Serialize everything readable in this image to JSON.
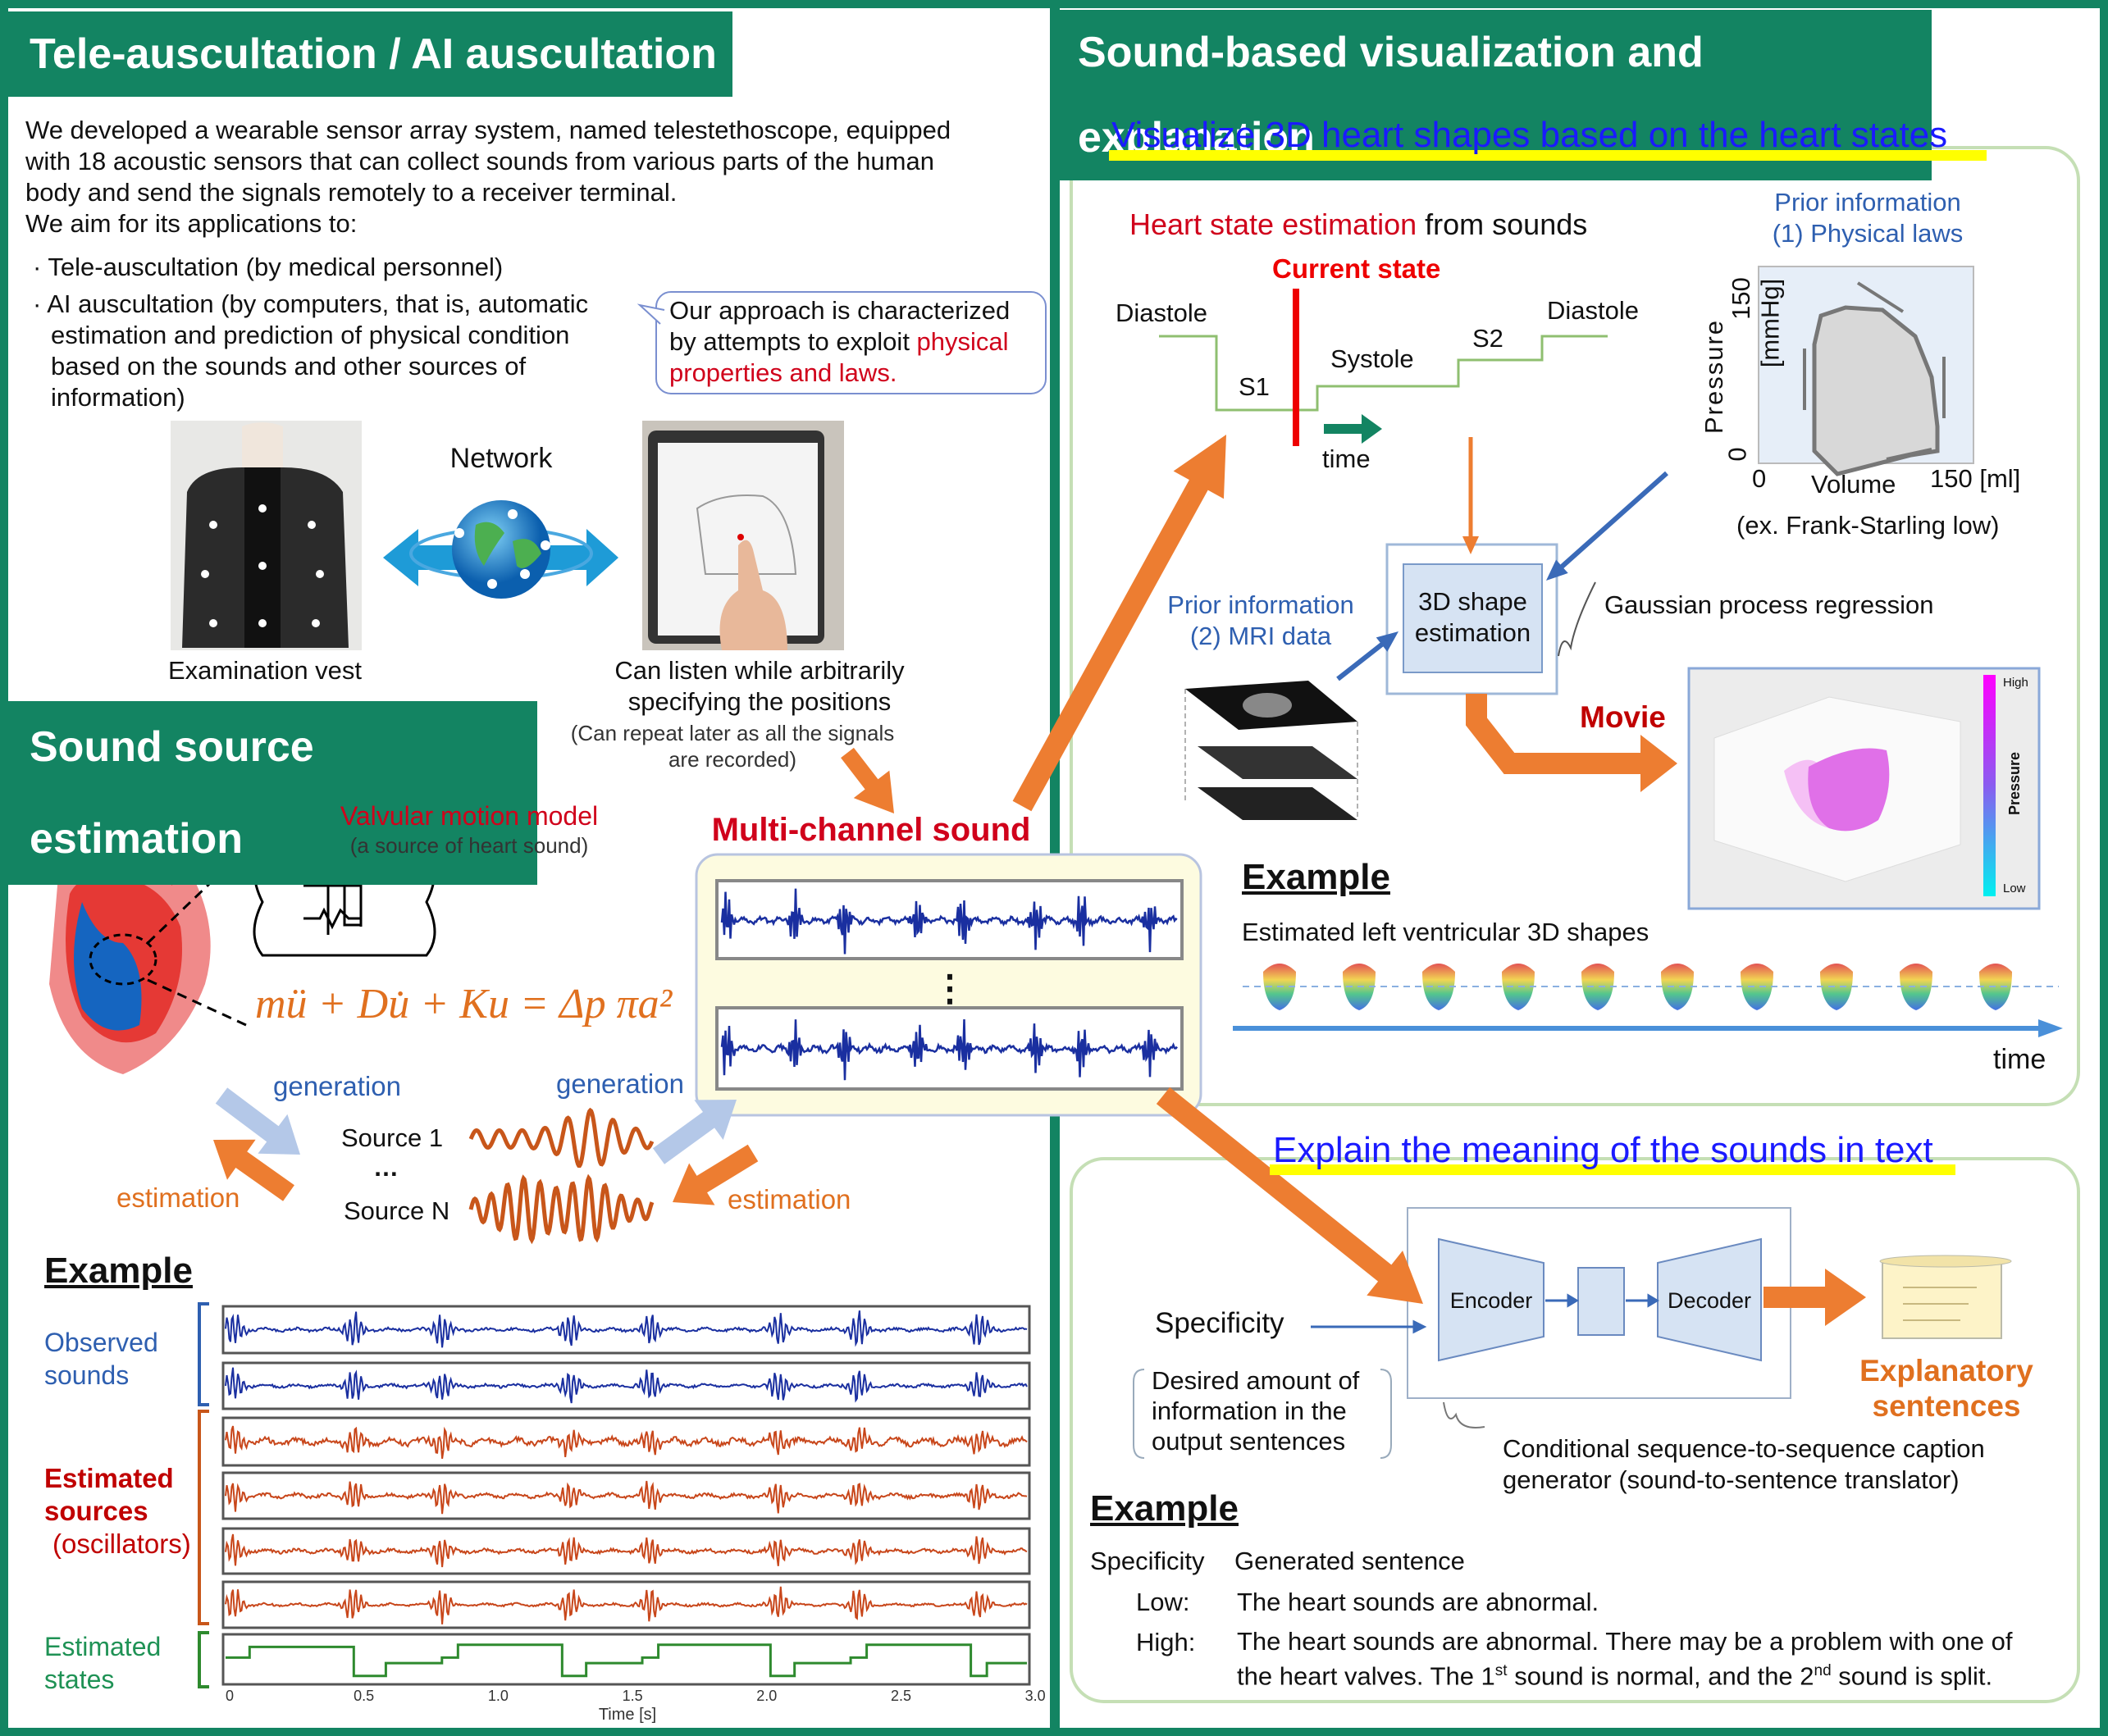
{
  "colors": {
    "frame_green": "#138462",
    "accent_orange": "#ed7d31",
    "accent_red": "#d0021b",
    "prior_blue": "#2e5fb0",
    "highlight_yellow": "#ffff00"
  },
  "left": {
    "title": "Tele-auscultation / AI auscultation",
    "intro": [
      "We developed a wearable sensor array system, named telestethoscope, equipped",
      "with 18 acoustic sensors that can collect sounds from various parts of the human",
      "body and send the signals remotely to a receiver terminal.",
      "We aim for its applications to:"
    ],
    "bullet_1": "Tele-auscultation (by medical personnel)",
    "bullet_2_lines": [
      "AI auscultation (by computers, that is, automatic",
      "estimation and prediction of physical condition",
      "based on the sounds and other sources of",
      "information)"
    ],
    "callout": {
      "line1": "Our approach is characterized",
      "line2": "by attempts to exploit ",
      "line2_red": "physical",
      "line3_red": "properties and laws."
    },
    "vest_label": "Examination vest",
    "network_label": "Network",
    "listen_lines": [
      "Can listen while arbitrarily",
      "specifying the positions"
    ],
    "repeat_lines": [
      "(Can repeat later as all the signals",
      "are recorded)"
    ]
  },
  "source": {
    "title": "Sound source estimation",
    "valve_title": "Valvular motion model",
    "valve_sub": "(a source of heart sound)",
    "equation": "mü + Du̇ + Ku = Δp πa²",
    "generation": "generation",
    "estimation": "estimation",
    "source_1": "Source 1",
    "ellipsis": "…",
    "source_n": "Source N",
    "multichannel": "Multi-channel sound",
    "vdots": "⋮"
  },
  "example_left": {
    "heading": "Example",
    "observed": [
      "Observed",
      "sounds"
    ],
    "estimated_sources": [
      "Estimated",
      "sources"
    ],
    "oscillators": "(oscillators)",
    "estimated_states": [
      "Estimated",
      "states"
    ],
    "x_ticks": [
      "0",
      "0.5",
      "1.0",
      "1.5",
      "2.0",
      "2.5",
      "3.0"
    ],
    "x_label": "Time [s]"
  },
  "right": {
    "title": "Sound-based visualization and explanation",
    "viz_title": "Visualize 3D heart shapes based on the heart states",
    "hse_red": "Heart state estimation",
    "hse_black": " from sounds",
    "current_state": "Current state",
    "diastole": "Diastole",
    "systole": "Systole",
    "s1": "S1",
    "s2": "S2",
    "time": "time",
    "prior1": [
      "Prior information",
      "(1) Physical laws"
    ],
    "pv": {
      "y_label": "Pressure",
      "y_max": "150",
      "y_unit": "[mmHg]",
      "y_min": "0",
      "x_min": "0",
      "x_label": "Volume",
      "x_max": "150 [ml]"
    },
    "frank": "(ex. Frank-Starling low)",
    "prior2": [
      "Prior information",
      "(2) MRI data"
    ],
    "shape_est": [
      "3D shape",
      "estimation"
    ],
    "gpr": "Gaussian process regression",
    "movie": "Movie",
    "colorbar": {
      "high": "High",
      "label": "Pressure",
      "low": "Low"
    },
    "example": "Example",
    "lv_label": "Estimated left ventricular 3D shapes",
    "time2": "time",
    "explain_title": "Explain the meaning of the sounds in text",
    "encoder": "Encoder",
    "decoder": "Decoder",
    "specificity": "Specificity",
    "desired": [
      "Desired amount of",
      "information in the",
      "output sentences"
    ],
    "explanatory": [
      "Explanatory",
      "sentences"
    ],
    "generator": [
      "Conditional sequence-to-sequence caption",
      "generator (sound-to-sentence translator)"
    ],
    "example2": "Example",
    "table": {
      "col_1": "Specificity",
      "col_2": "Generated sentence",
      "low_label": "Low:",
      "low_text": "The heart sounds are abnormal.",
      "high_label": "High:",
      "high_line1": "The heart sounds are abnormal. There may be a problem with one of",
      "high_line2": [
        "the heart valves. The 1",
        "st",
        " sound is normal, and the 2",
        "nd",
        " sound is split."
      ]
    }
  }
}
